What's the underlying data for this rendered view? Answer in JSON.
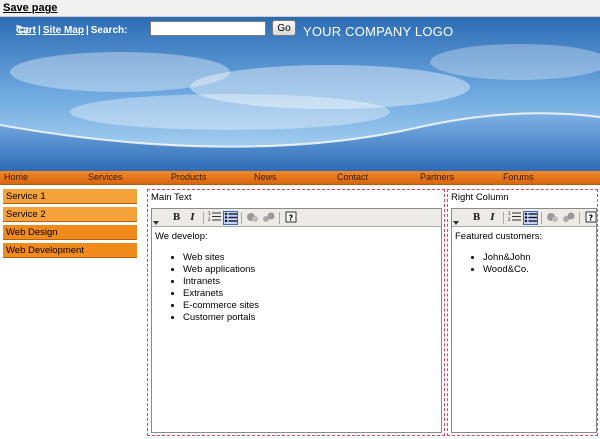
{
  "savebar": {
    "save_label": "Save page"
  },
  "header": {
    "cart": "Cart",
    "sitemap": "Site Map",
    "sep": "|",
    "search_label": "Search:",
    "search_value": "",
    "go_label": "Go",
    "logo": "YOUR COMPANY LOGO"
  },
  "nav": [
    "Home",
    "Services",
    "Products",
    "News",
    "Contact",
    "Partners",
    "Forums"
  ],
  "leftmenu": [
    "Service 1",
    "Service 2",
    "Web Design",
    "Web Development"
  ],
  "main": {
    "title": "Main Text",
    "intro": "We develop:",
    "items": [
      "Web sites",
      "Web applications",
      "Intranets",
      "Extranets",
      "E-commerce sites",
      "Customer portals"
    ]
  },
  "right": {
    "title": "Right Column",
    "intro": "Featured customers:",
    "items": [
      "John&John",
      "Wood&Co."
    ]
  },
  "toolbar": {
    "bold": "B",
    "italic": "I"
  },
  "colors": {
    "nav_orange": "#e8761c",
    "menu_light": "#f6a23a",
    "menu_dark": "#f08a1a",
    "zone_border": "#e04060"
  }
}
